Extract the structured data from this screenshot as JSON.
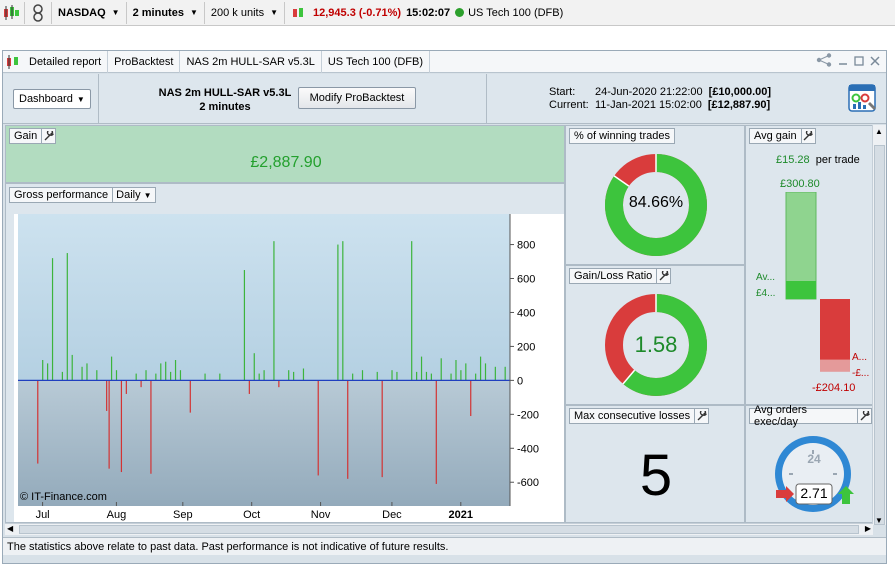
{
  "toolbar": {
    "instrument": "NASDAQ",
    "timeframe": "2 minutes",
    "units": "200 k units",
    "price_change": "12,945.3 (-0.71%)",
    "time": "15:02:07",
    "market": "US Tech 100 (DFB)"
  },
  "window": {
    "tabs": [
      "Detailed report",
      "ProBacktest",
      "NAS 2m HULL-SAR v5.3L",
      "US Tech 100 (DFB)"
    ]
  },
  "header": {
    "dashboard_label": "Dashboard",
    "strategy_name": "NAS 2m HULL-SAR v5.3L",
    "strategy_timeframe": "2 minutes",
    "modify_label": "Modify ProBacktest",
    "start_label": "Start:",
    "start_date": "24-Jun-2020 21:22:00",
    "start_capital": "[£10,000.00]",
    "current_label": "Current:",
    "current_date": "11-Jan-2021 15:02:00",
    "current_capital": "[£12,887.90]"
  },
  "gain": {
    "title": "Gain",
    "value": "£2,887.90"
  },
  "gross_performance": {
    "title": "Gross performance",
    "period": "Daily",
    "copyright": "© IT-Finance.com"
  },
  "winning_trades": {
    "title": "% of winning trades",
    "value": "84.66%",
    "fraction": 0.8466
  },
  "gain_loss_ratio": {
    "title": "Gain/Loss Ratio",
    "value": "1.58",
    "gain_fraction": 0.612
  },
  "max_losses": {
    "title": "Max consecutive losses",
    "value": "5"
  },
  "avg_gain": {
    "title": "Avg gain",
    "per_trade_value": "£15.28",
    "per_trade_label": "per trade",
    "top_value": "£300.80",
    "left_label_1": "Av...",
    "left_label_2": "£4...",
    "right_label_1": "A...",
    "right_label_2": "-£...",
    "bottom_value": "-£204.10",
    "avg_win": 300.8,
    "avg_loss": -204.1
  },
  "avg_orders": {
    "title": "Avg orders exec/day",
    "clock_label": "24",
    "value": "2.71"
  },
  "footer": {
    "disclaimer": "The statistics above relate to past data. Past performance is not indicative of future results."
  },
  "colors": {
    "green": "#3dc43d",
    "red": "#d93c3c",
    "gain_bg": "#b2dcc0",
    "chart_bar_pos": "#3cb43c",
    "chart_bar_neg": "#d33333",
    "zero_line": "#1f3fbf"
  },
  "chart_data": {
    "type": "bar",
    "title": "Gross performance",
    "period": "Daily",
    "x_ticks": [
      "Jul",
      "Aug",
      "Sep",
      "Oct",
      "Nov",
      "Dec",
      "2021"
    ],
    "y_ticks": [
      800,
      600,
      400,
      200,
      0,
      -200,
      -400,
      -600
    ],
    "ylim": [
      -740,
      980
    ],
    "xlim": [
      0,
      200
    ],
    "x_tick_positions": [
      10,
      40,
      67,
      95,
      123,
      152,
      180
    ],
    "series": [
      {
        "values": [
          [
            8,
            -490
          ],
          [
            10,
            120
          ],
          [
            12,
            100
          ],
          [
            14,
            720
          ],
          [
            18,
            50
          ],
          [
            20,
            750
          ],
          [
            22,
            150
          ],
          [
            26,
            80
          ],
          [
            28,
            100
          ],
          [
            32,
            60
          ],
          [
            36,
            -180
          ],
          [
            37,
            -520
          ],
          [
            38,
            140
          ],
          [
            40,
            60
          ],
          [
            42,
            -540
          ],
          [
            44,
            -80
          ],
          [
            48,
            40
          ],
          [
            50,
            -40
          ],
          [
            52,
            60
          ],
          [
            54,
            -550
          ],
          [
            56,
            40
          ],
          [
            58,
            100
          ],
          [
            60,
            110
          ],
          [
            62,
            50
          ],
          [
            64,
            120
          ],
          [
            66,
            60
          ],
          [
            70,
            -190
          ],
          [
            76,
            40
          ],
          [
            82,
            40
          ],
          [
            92,
            650
          ],
          [
            94,
            -80
          ],
          [
            96,
            160
          ],
          [
            98,
            40
          ],
          [
            100,
            60
          ],
          [
            104,
            820
          ],
          [
            106,
            -40
          ],
          [
            110,
            60
          ],
          [
            112,
            50
          ],
          [
            116,
            70
          ],
          [
            122,
            -560
          ],
          [
            130,
            800
          ],
          [
            132,
            820
          ],
          [
            134,
            -580
          ],
          [
            136,
            40
          ],
          [
            140,
            60
          ],
          [
            146,
            50
          ],
          [
            148,
            -570
          ],
          [
            152,
            60
          ],
          [
            154,
            50
          ],
          [
            160,
            820
          ],
          [
            162,
            50
          ],
          [
            164,
            140
          ],
          [
            166,
            50
          ],
          [
            168,
            40
          ],
          [
            170,
            -610
          ],
          [
            172,
            130
          ],
          [
            176,
            40
          ],
          [
            178,
            120
          ],
          [
            180,
            60
          ],
          [
            182,
            100
          ],
          [
            184,
            -210
          ],
          [
            186,
            40
          ],
          [
            188,
            140
          ],
          [
            190,
            100
          ],
          [
            194,
            80
          ],
          [
            198,
            80
          ]
        ]
      }
    ]
  }
}
